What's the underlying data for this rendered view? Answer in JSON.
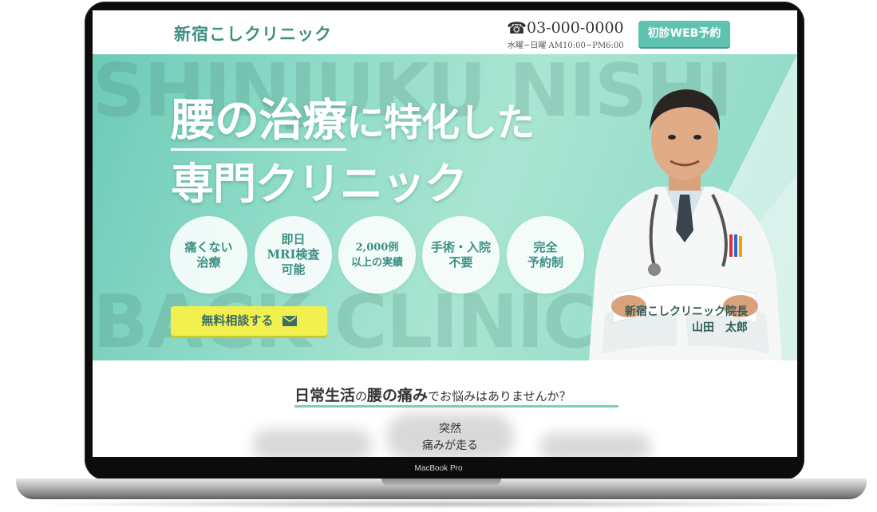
{
  "device": {
    "label": "MacBook Pro"
  },
  "header": {
    "logo": "新宿こしクリニック",
    "phone_icon": "☎",
    "phone": "03-000-0000",
    "hours": "水曜~日曜 AM10:00~PM6:00",
    "reserve_label": "初診WEB予約"
  },
  "hero": {
    "watermark_top": "SHINJUKU NISHI",
    "watermark_bottom": "BACK CLINIC",
    "headline": {
      "part1": "腰の治療",
      "part2": "に特化した",
      "line2": "専門クリニック"
    },
    "features": [
      "痛くない\n治療",
      "即日\nMRI検査\n可能",
      "2,000例\n以上の実績",
      "手術・入院\n不要",
      "完全\n予約制"
    ],
    "consult_label": "無料相談する",
    "doctor_title": "新宿こしクリニック院長",
    "doctor_name": "山田　太郎"
  },
  "section": {
    "title_a": "日常生活",
    "title_b": "の",
    "title_c": "腰の痛み",
    "title_d": "でお悩みはありませんか？",
    "symptom": "突然\n痛みが走る"
  },
  "colors": {
    "accent": "#5fc2b1",
    "button_yellow": "#f2f04e",
    "logo": "#3f8f83"
  }
}
